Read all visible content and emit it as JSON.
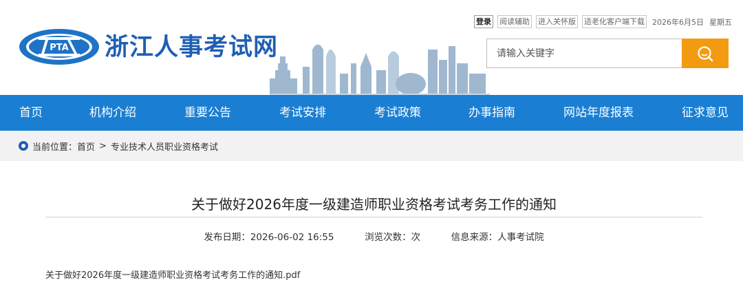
{
  "header": {
    "logo_text": "PTA",
    "site_name": "浙江人事考试网",
    "top_links": {
      "login": "登录",
      "reading_aid": "阅读辅助",
      "care_mode": "进入关怀版",
      "elderly_client": "适老化客户端下载"
    },
    "date": "2026年6月5日",
    "weekday": "星期五",
    "search": {
      "placeholder": "请输入关键字",
      "icon": "search-icon"
    }
  },
  "nav": {
    "items": [
      {
        "label": "首页"
      },
      {
        "label": "机构介绍"
      },
      {
        "label": "重要公告"
      },
      {
        "label": "考试安排"
      },
      {
        "label": "考试政策"
      },
      {
        "label": "办事指南"
      },
      {
        "label": "网站年度报表"
      },
      {
        "label": "征求意见"
      }
    ]
  },
  "breadcrumb": {
    "prefix": "当前位置：",
    "home": "首页",
    "separator": ">",
    "current": "专业技术人员职业资格考试"
  },
  "article": {
    "title": "关于做好2026年度一级建造师职业资格考试考务工作的通知",
    "publish_label": "发布日期：",
    "publish_date": "2026-06-02 16:55",
    "views_label": "浏览次数：",
    "views_unit": "次",
    "source_label": "信息来源：",
    "source": "人事考试院",
    "attachment": "关于做好2026年度一级建造师职业资格考试考务工作的通知.pdf"
  },
  "colors": {
    "brand_blue": "#1f5fb4",
    "nav_blue": "#1a7fd3",
    "search_orange": "#f29b11",
    "crumb_bg": "#f2f2f2"
  }
}
